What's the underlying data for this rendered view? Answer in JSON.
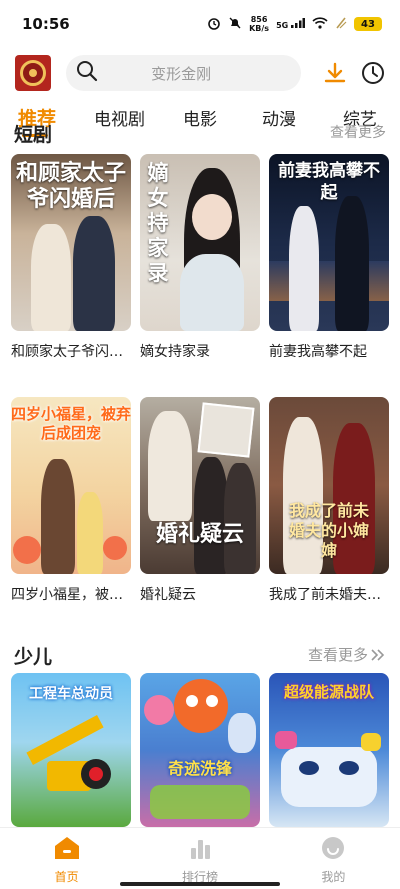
{
  "status_bar": {
    "time": "10:56",
    "net_speed_value": "856",
    "net_speed_unit": "KB/s",
    "network": "5G",
    "battery": "43"
  },
  "header": {
    "search_placeholder": "变形金刚"
  },
  "tabs": [
    {
      "label": "推荐",
      "active": true
    },
    {
      "label": "电视剧",
      "active": false
    },
    {
      "label": "电影",
      "active": false
    },
    {
      "label": "动漫",
      "active": false
    },
    {
      "label": "综艺",
      "active": false
    }
  ],
  "short_drama_section": {
    "title": "短剧",
    "more": "查看更多"
  },
  "short_dramas": [
    {
      "title": "和顾家太子爷闪婚后",
      "poster_text": "和顾家太子爷闪婚后"
    },
    {
      "title": "嫡女持家录",
      "poster_text": "嫡女持家录"
    },
    {
      "title": "前妻我高攀不起",
      "poster_text": "前妻我高攀不起"
    },
    {
      "title": "四岁小福星，被弃后成团宠",
      "poster_text": "四岁小福星，被弃后成团宠"
    },
    {
      "title": "婚礼疑云",
      "poster_text": "婚礼疑云"
    },
    {
      "title": "我成了前未婚夫的小婶婶",
      "poster_text": "我成了前未婚夫的小婶婶"
    }
  ],
  "kids_section": {
    "title": "少儿",
    "more": "查看更多"
  },
  "kids": [
    {
      "poster_text": "工程车总动员"
    },
    {
      "poster_text": "奇迹洗锋"
    },
    {
      "poster_text": "超级能源战队"
    }
  ],
  "bottom_nav": [
    {
      "label": "首页",
      "active": true,
      "icon": "home-icon"
    },
    {
      "label": "排行榜",
      "active": false,
      "icon": "chart-icon"
    },
    {
      "label": "我的",
      "active": false,
      "icon": "smile-icon"
    }
  ],
  "colors": {
    "accent": "#f08a00",
    "text": "#222222",
    "muted": "#999999"
  }
}
